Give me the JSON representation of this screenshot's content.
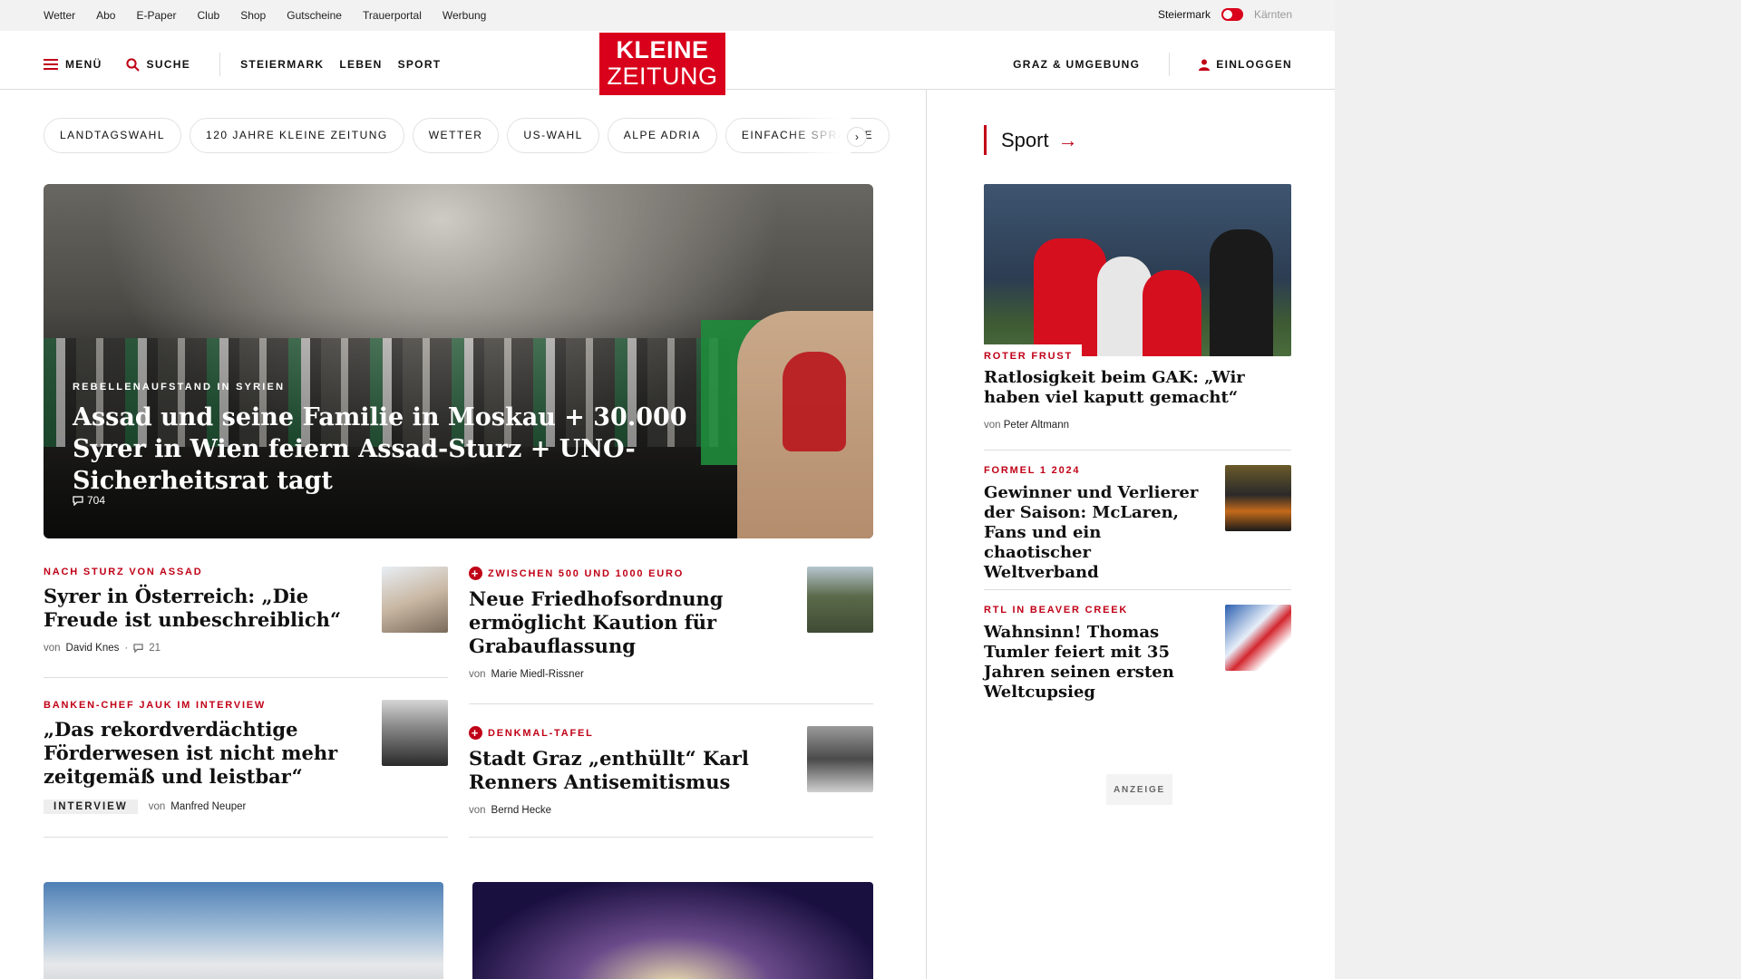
{
  "utility": {
    "links": [
      "Wetter",
      "Abo",
      "E-Paper",
      "Club",
      "Shop",
      "Gutscheine",
      "Trauerportal",
      "Werbung"
    ],
    "region_active": "Steiermark",
    "region_inactive": "Kärnten"
  },
  "nav": {
    "menu_label": "MENÜ",
    "search_label": "SUCHE",
    "categories": [
      "STEIERMARK",
      "LEBEN",
      "SPORT"
    ],
    "logo_line1": "KLEINE",
    "logo_line2": "ZEITUNG",
    "region_link": "GRAZ & UMGEBUNG",
    "login_label": "EINLOGGEN"
  },
  "chips": [
    "LANDTAGSWAHL",
    "120 JAHRE KLEINE ZEITUNG",
    "WETTER",
    "US-WAHL",
    "ALPE ADRIA",
    "EINFACHE SPRACHE"
  ],
  "hero": {
    "kicker": "REBELLENAUFSTAND IN SYRIEN",
    "title": "Assad und seine Familie in Moskau + 30.000 Syrer in Wien feiern Assad-Sturz + UNO-Sicherheitsrat tagt",
    "comments": "704"
  },
  "teasers": [
    {
      "kicker": "NACH STURZ VON ASSAD",
      "title": "Syrer in Österreich: „Die Freude ist unbeschreiblich“",
      "by": "von",
      "author": "David Knes",
      "comments": "21"
    },
    {
      "kicker": "ZWISCHEN 500 UND 1000 EURO",
      "title": "Neue Friedhofsordnung ermöglicht Kaution für Grabauflassung",
      "by": "von",
      "author": "Marie Miedl-Rissner"
    },
    {
      "kicker": "BANKEN-CHEF JAUK IM INTERVIEW",
      "title": "„Das rekordverdächtige Förderwesen ist nicht mehr zeitgemäß und leistbar“",
      "tag": "INTERVIEW",
      "by": "von",
      "author": "Manfred Neuper"
    },
    {
      "kicker": "DENKMAL-TAFEL",
      "title": "Stadt Graz „enthüllt“ Karl Renners Antisemitismus",
      "by": "von",
      "author": "Bernd Hecke"
    }
  ],
  "sport": {
    "heading": "Sport",
    "lead": {
      "kicker": "ROTER FRUST",
      "title": "Ratlosigkeit beim GAK: „Wir haben viel kaputt gemacht“",
      "by": "von",
      "author": "Peter Altmann"
    },
    "items": [
      {
        "kicker": "FORMEL 1 2024",
        "title": "Gewinner und Verlierer der Saison: McLaren, Fans und ein chaotischer Weltverband"
      },
      {
        "kicker": "RTL IN BEAVER CREEK",
        "title": "Wahnsinn! Thomas Tumler feiert mit 35 Jahren seinen ersten Weltcupsieg"
      }
    ],
    "ad_label": "ANZEIGE"
  },
  "colors": {
    "brand_red": "#d9001b",
    "kicker_red": "#c00016"
  }
}
